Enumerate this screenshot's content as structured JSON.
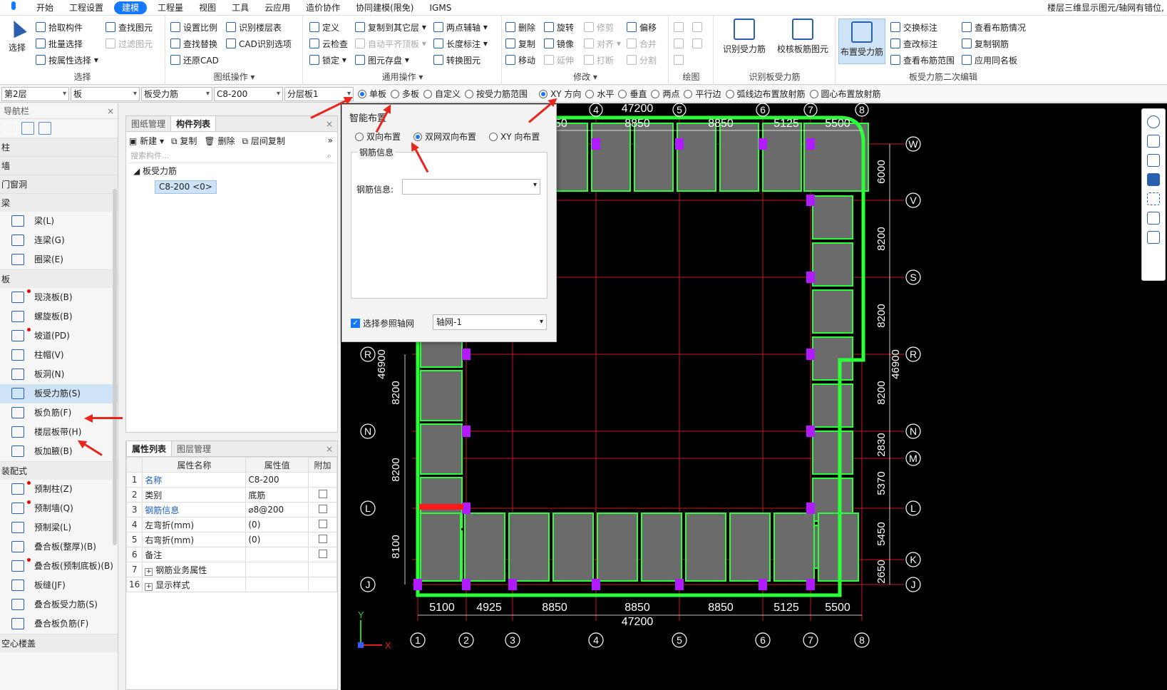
{
  "menu": {
    "items": [
      "开始",
      "工程设置",
      "建模",
      "工程量",
      "视图",
      "工具",
      "云应用",
      "造价协作",
      "协同建模(限免)",
      "IGMS"
    ],
    "active_index": 2,
    "right_title": "楼层三维显示图元/轴网有错位,"
  },
  "ribbon": {
    "select_group": {
      "big": "选择",
      "pick": "拾取构件",
      "batch": "批量选择",
      "by_attr": "按属性选择",
      "find": "查找图元",
      "filter": "过滤图元",
      "title": "选择"
    },
    "drawing_group": {
      "scale": "设置比例",
      "find_replace": "查找替换",
      "restore_cad": "还原CAD",
      "floor_table": "识别楼层表",
      "cad_options": "CAD识别选项",
      "title": "图纸操作"
    },
    "common_group": {
      "define": "定义",
      "cloud_check": "云检查",
      "lock": "锁定",
      "copy_to_floor": "复制到其它层",
      "auto_flat": "自动平齐顶板",
      "element_save": "图元存盘",
      "two_point_axis": "两点辅轴",
      "length_mark": "长度标注",
      "convert_element": "转换图元",
      "title": "通用操作"
    },
    "modify_group": {
      "delete": "删除",
      "copy": "复制",
      "move": "移动",
      "rotate": "旋转",
      "mirror": "镜像",
      "extend": "延伸",
      "trim": "修剪",
      "align": "对齐",
      "break": "打断",
      "offset": "偏移",
      "merge": "合并",
      "split": "分割",
      "title": "修改"
    },
    "draw_group": {
      "title": "绘图"
    },
    "identify_group": {
      "identify": "识别受力筋",
      "check": "校核板筋图元",
      "title": "识别板受力筋"
    },
    "edit_group": {
      "place": "布置受力筋",
      "swap_mark": "交换标注",
      "check_mark": "查改标注",
      "view_range": "查看布筋范围",
      "view_layout": "查看布筋情况",
      "copy_rebar": "复制钢筋",
      "apply_same": "应用同名板",
      "title": "板受力筋二次编辑"
    }
  },
  "toolbar2": {
    "floor": "第2层",
    "type": "板",
    "subtype": "板受力筋",
    "spec": "C8-200",
    "layer": "分层板1",
    "radios1": [
      "单板",
      "多板",
      "自定义",
      "按受力筋范围"
    ],
    "radios1_selected": 0,
    "radios2": [
      "XY 方向",
      "水平",
      "垂直",
      "两点",
      "平行边",
      "弧线边布置放射筋",
      "圆心布置放射筋"
    ],
    "radios2_selected": 0
  },
  "nav": {
    "header": "导航栏",
    "categories": [
      {
        "label": "柱",
        "items": []
      },
      {
        "label": "墙",
        "items": []
      },
      {
        "label": "门窗洞",
        "items": []
      },
      {
        "label": "梁",
        "items": [
          {
            "label": "梁(L)",
            "dot": false
          },
          {
            "label": "连梁(G)",
            "dot": false
          },
          {
            "label": "圈梁(E)",
            "dot": false
          }
        ]
      },
      {
        "label": "板",
        "items": [
          {
            "label": "现浇板(B)",
            "dot": true
          },
          {
            "label": "螺旋板(B)",
            "dot": false
          },
          {
            "label": "坡道(PD)",
            "dot": true
          },
          {
            "label": "柱帽(V)",
            "dot": false
          },
          {
            "label": "板洞(N)",
            "dot": false
          },
          {
            "label": "板受力筋(S)",
            "dot": false,
            "sel": true
          },
          {
            "label": "板负筋(F)",
            "dot": false
          },
          {
            "label": "楼层板带(H)",
            "dot": false
          },
          {
            "label": "板加腋(B)",
            "dot": false
          }
        ]
      },
      {
        "label": "装配式",
        "items": [
          {
            "label": "预制柱(Z)",
            "dot": true
          },
          {
            "label": "预制墙(Q)",
            "dot": true
          },
          {
            "label": "预制梁(L)",
            "dot": false
          },
          {
            "label": "叠合板(整厚)(B)",
            "dot": false
          },
          {
            "label": "叠合板(预制底板)(B)",
            "dot": true
          },
          {
            "label": "板缝(JF)",
            "dot": false
          },
          {
            "label": "叠合板受力筋(S)",
            "dot": false
          },
          {
            "label": "叠合板负筋(F)",
            "dot": false
          }
        ]
      },
      {
        "label": "空心楼盖",
        "items": []
      }
    ]
  },
  "component_panel": {
    "tabs": [
      "图纸管理",
      "构件列表"
    ],
    "active_tab": 1,
    "new": "新建",
    "copy": "复制",
    "delete": "删除",
    "floor_copy": "层间复制",
    "search_placeholder": "搜索构件...",
    "tree_root": "板受力筋",
    "tree_child": "C8-200 <0>"
  },
  "property_panel": {
    "tabs": [
      "属性列表",
      "图层管理"
    ],
    "headers": [
      "属性名称",
      "属性值",
      "附加"
    ],
    "rows": [
      {
        "num": "1",
        "name": "名称",
        "value": "C8-200",
        "blue": true,
        "check": false
      },
      {
        "num": "2",
        "name": "类别",
        "value": "底筋",
        "blue": false,
        "check": true
      },
      {
        "num": "3",
        "name": "钢筋信息",
        "value": "⌀8@200",
        "blue": true,
        "check": true
      },
      {
        "num": "4",
        "name": "左弯折(mm)",
        "value": "(0)",
        "blue": false,
        "check": true
      },
      {
        "num": "5",
        "name": "右弯折(mm)",
        "value": "(0)",
        "blue": false,
        "check": true
      },
      {
        "num": "6",
        "name": "备注",
        "value": "",
        "blue": false,
        "check": true
      },
      {
        "num": "7",
        "name": "钢筋业务属性",
        "value": "",
        "blue": false,
        "check": false,
        "expand": true
      },
      {
        "num": "16",
        "name": "显示样式",
        "value": "",
        "blue": false,
        "check": false,
        "expand": true
      }
    ]
  },
  "dialog": {
    "title": "智能布置",
    "options": [
      "双向布置",
      "双网双向布置",
      "XY 向布置"
    ],
    "selected": 1,
    "group_label": "钢筋信息",
    "field_label": "钢筋信息:",
    "field_value": "",
    "ref_axis_label": "选择参照轴网",
    "ref_axis_value": "轴网-1"
  },
  "plan": {
    "top_total": "47200",
    "bottom_total": "47200",
    "top_dims": [
      "8850",
      "8850",
      "8850",
      "5125",
      "5500"
    ],
    "bottom_dims": [
      "5100",
      "4925",
      "8850",
      "8850",
      "8850",
      "5125",
      "5500"
    ],
    "col_axes": [
      "1",
      "2",
      "3",
      "4",
      "5",
      "6",
      "7",
      "8"
    ],
    "top_axes": [
      "4",
      "5",
      "6",
      "7",
      "8"
    ],
    "row_axes_right": [
      "W",
      "V",
      "S",
      "R",
      "N",
      "M",
      "L",
      "K",
      "J"
    ],
    "row_axes_left": [
      "R",
      "N",
      "L",
      "J"
    ],
    "right_dims": [
      "6000",
      "8200",
      "8200",
      "8200",
      "2830",
      "5370",
      "5450",
      "2650"
    ],
    "right_total": "46900",
    "left_total": "46900",
    "left_dims": [
      "8200",
      "8200",
      "8100"
    ],
    "axis_x": "X",
    "axis_y": "Y"
  }
}
